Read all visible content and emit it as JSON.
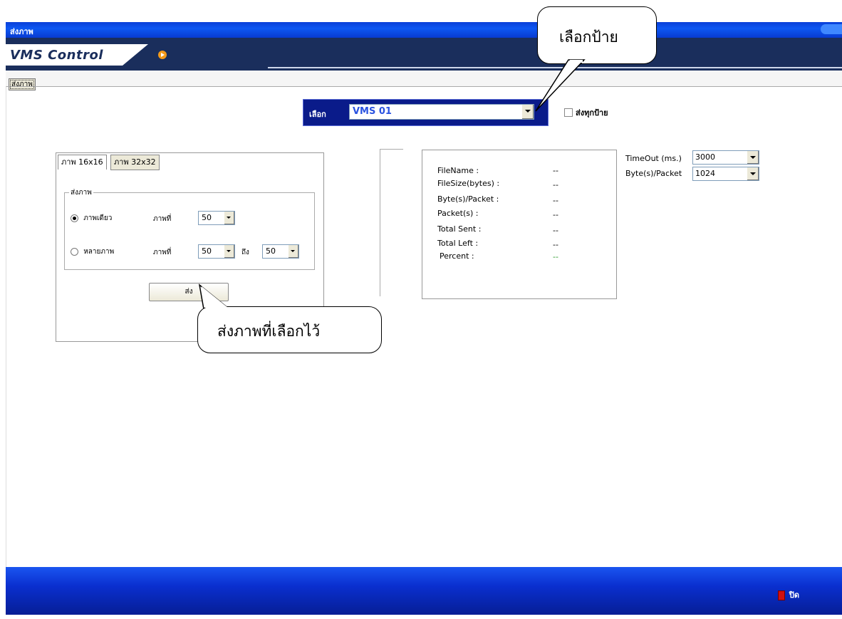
{
  "window": {
    "title": "ส่งภาพ"
  },
  "header": {
    "logo": "VMS Control"
  },
  "tabs": {
    "main": "ส่งภาพ"
  },
  "selector": {
    "label": "เลือก",
    "value": "VMS 01",
    "send_all_label": "ส่งทุกป้าย"
  },
  "image_panel": {
    "tab_16": "ภาพ 16x16",
    "tab_32": "ภาพ 32x32",
    "group_label": "ส่งภาพ",
    "single": {
      "label": "ภาพเดียว",
      "image_no_label": "ภาพที่",
      "value": "50"
    },
    "multi": {
      "label": "หลายภาพ",
      "image_no_label": "ภาพที่",
      "from": "50",
      "to_label": "ถึง",
      "to": "50"
    },
    "send_button": "ส่ง"
  },
  "info": {
    "rows": [
      {
        "label": "FileName :",
        "value": "--"
      },
      {
        "label": "FileSize(bytes) :",
        "value": "--"
      },
      {
        "label": "Byte(s)/Packet :",
        "value": "--"
      },
      {
        "label": "Packet(s) :",
        "value": "--"
      },
      {
        "label": "Total Sent :",
        "value": "--"
      },
      {
        "label": "Total Left :",
        "value": "--"
      },
      {
        "label": "Percent :",
        "value": "--"
      }
    ]
  },
  "settings": {
    "timeout_label": "TimeOut (ms.)",
    "timeout_value": "3000",
    "packet_label": "Byte(s)/Packet",
    "packet_value": "1024"
  },
  "footer": {
    "close_label": "ปิด"
  },
  "callouts": {
    "select_sign": "เลือกป้าย",
    "send_selected": "ส่งภาพที่เลือกไว้"
  }
}
